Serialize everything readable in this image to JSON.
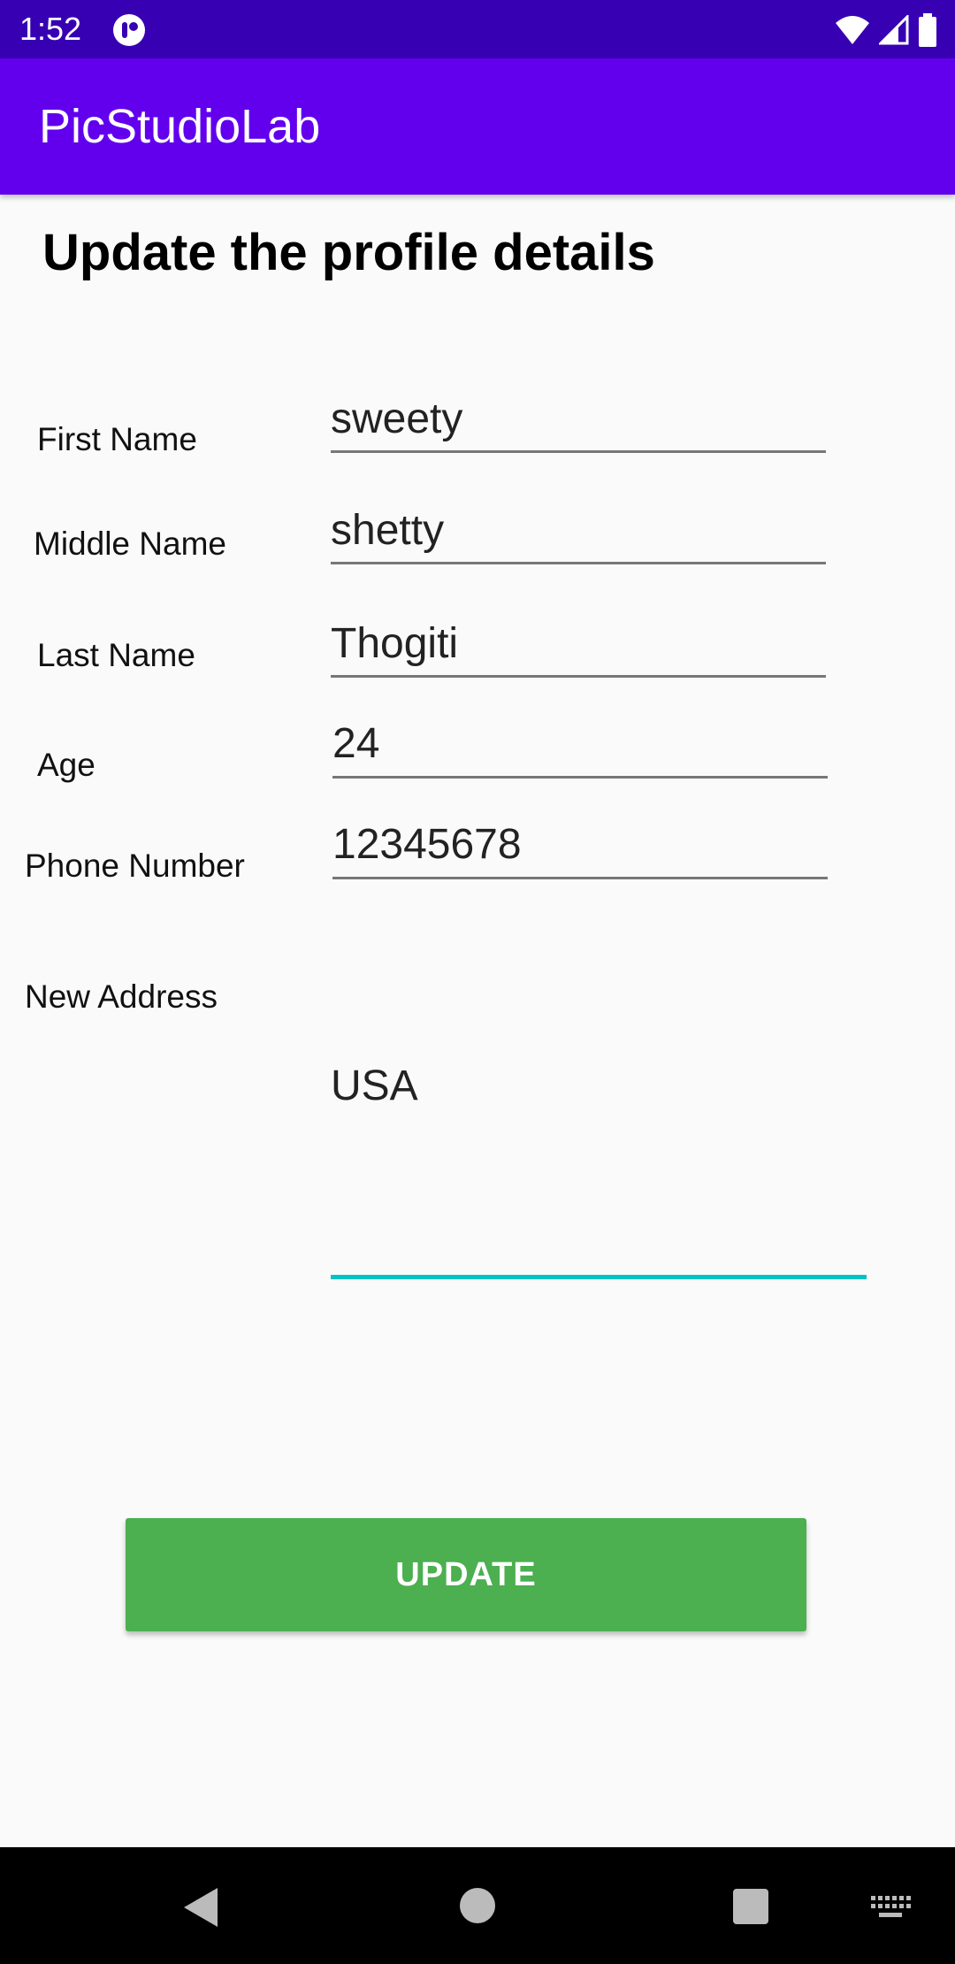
{
  "status_bar": {
    "time": "1:52",
    "icons": [
      "app-notification-icon",
      "wifi-icon",
      "cellular-signal-icon",
      "battery-icon"
    ]
  },
  "app_bar": {
    "title": "PicStudioLab"
  },
  "page": {
    "heading": "Update the profile details"
  },
  "form": {
    "first_name": {
      "label": "First Name",
      "value": "sweety"
    },
    "middle_name": {
      "label": "Middle Name",
      "value": "shetty"
    },
    "last_name": {
      "label": "Last Name",
      "value": "Thogiti"
    },
    "age": {
      "label": "Age",
      "value": "24"
    },
    "phone": {
      "label": "Phone Number",
      "value": "12345678"
    },
    "address": {
      "label": "New Address",
      "value": "USA"
    }
  },
  "actions": {
    "update_label": "UPDATE"
  },
  "colors": {
    "status_bar": "#3700b3",
    "app_bar": "#6200ee",
    "update_button": "#4caf50",
    "focused_underline": "#00c4c4"
  },
  "nav_bar": {
    "icons": [
      "back-icon",
      "home-icon",
      "recents-icon",
      "keyboard-icon"
    ]
  }
}
